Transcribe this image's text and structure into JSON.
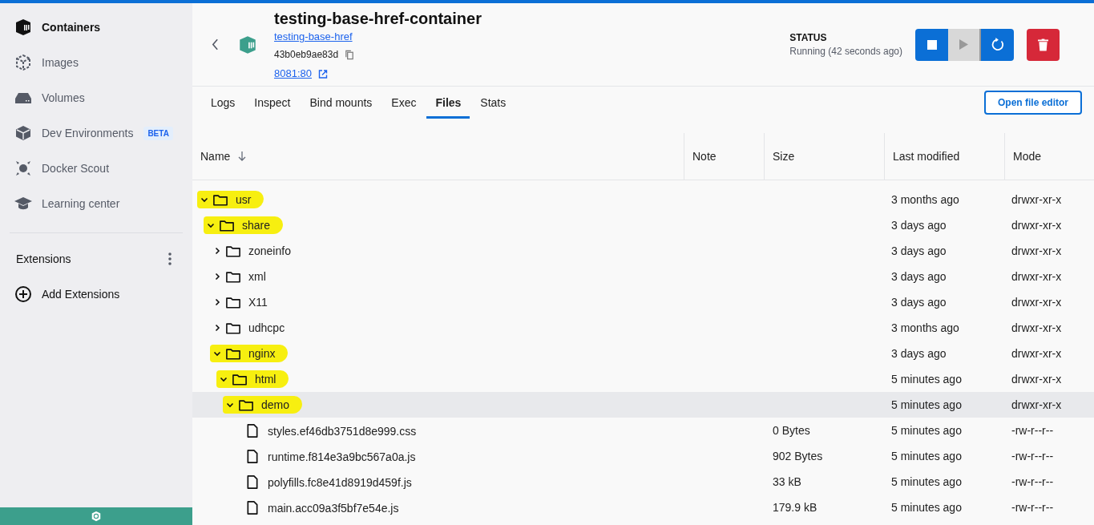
{
  "sidebar": {
    "items": [
      {
        "label": "Containers",
        "selected": true
      },
      {
        "label": "Images",
        "selected": false
      },
      {
        "label": "Volumes",
        "selected": false
      },
      {
        "label": "Dev Environments",
        "selected": false,
        "badge": "BETA"
      },
      {
        "label": "Docker Scout",
        "selected": false
      },
      {
        "label": "Learning center",
        "selected": false
      }
    ],
    "extensions_label": "Extensions",
    "add_extensions": "Add Extensions"
  },
  "header": {
    "title": "testing-base-href-container",
    "image_link": "testing-base-href",
    "container_id": "43b0eb9ae83d",
    "port_link": "8081:80",
    "status_label": "STATUS",
    "status_text": "Running (42 seconds ago)"
  },
  "tabs": [
    {
      "label": "Logs",
      "selected": false
    },
    {
      "label": "Inspect",
      "selected": false
    },
    {
      "label": "Bind mounts",
      "selected": false
    },
    {
      "label": "Exec",
      "selected": false
    },
    {
      "label": "Files",
      "selected": true
    },
    {
      "label": "Stats",
      "selected": false
    }
  ],
  "open_file_editor": "Open file editor",
  "table": {
    "columns": [
      "Name",
      "Note",
      "Size",
      "Last modified",
      "Mode"
    ],
    "tree": [
      {
        "name": "usr",
        "kind": "folder",
        "expanded": true,
        "highlighted": true,
        "selected": false,
        "modified": "3 months ago",
        "mode": "drwxr-xr-x",
        "children": [
          {
            "name": "share",
            "kind": "folder",
            "expanded": true,
            "highlighted": true,
            "selected": false,
            "modified": "3 days ago",
            "mode": "drwxr-xr-x",
            "children": [
              {
                "name": "zoneinfo",
                "kind": "folder",
                "expanded": false,
                "highlighted": false,
                "selected": false,
                "modified": "3 days ago",
                "mode": "drwxr-xr-x"
              },
              {
                "name": "xml",
                "kind": "folder",
                "expanded": false,
                "highlighted": false,
                "selected": false,
                "modified": "3 days ago",
                "mode": "drwxr-xr-x"
              },
              {
                "name": "X11",
                "kind": "folder",
                "expanded": false,
                "highlighted": false,
                "selected": false,
                "modified": "3 days ago",
                "mode": "drwxr-xr-x"
              },
              {
                "name": "udhcpc",
                "kind": "folder",
                "expanded": false,
                "highlighted": false,
                "selected": false,
                "modified": "3 months ago",
                "mode": "drwxr-xr-x"
              },
              {
                "name": "nginx",
                "kind": "folder",
                "expanded": true,
                "highlighted": true,
                "selected": false,
                "modified": "3 days ago",
                "mode": "drwxr-xr-x",
                "children": [
                  {
                    "name": "html",
                    "kind": "folder",
                    "expanded": true,
                    "highlighted": true,
                    "selected": false,
                    "modified": "5 minutes ago",
                    "mode": "drwxr-xr-x",
                    "children": [
                      {
                        "name": "demo",
                        "kind": "folder",
                        "expanded": true,
                        "highlighted": true,
                        "selected": true,
                        "modified": "5 minutes ago",
                        "mode": "drwxr-xr-x",
                        "children": [
                          {
                            "name": "styles.ef46db3751d8e999.css",
                            "kind": "file",
                            "highlighted": false,
                            "selected": false,
                            "size": "0 Bytes",
                            "modified": "5 minutes ago",
                            "mode": "-rw-r--r--"
                          },
                          {
                            "name": "runtime.f814e3a9bc567a0a.js",
                            "kind": "file",
                            "highlighted": false,
                            "selected": false,
                            "size": "902 Bytes",
                            "modified": "5 minutes ago",
                            "mode": "-rw-r--r--"
                          },
                          {
                            "name": "polyfills.fc8e41d8919d459f.js",
                            "kind": "file",
                            "highlighted": false,
                            "selected": false,
                            "size": "33 kB",
                            "modified": "5 minutes ago",
                            "mode": "-rw-r--r--"
                          },
                          {
                            "name": "main.acc09a3f5bf7e54e.js",
                            "kind": "file",
                            "highlighted": false,
                            "selected": false,
                            "size": "179.9 kB",
                            "modified": "5 minutes ago",
                            "mode": "-rw-r--r--"
                          }
                        ]
                      }
                    ]
                  }
                ]
              }
            ]
          }
        ]
      }
    ]
  }
}
